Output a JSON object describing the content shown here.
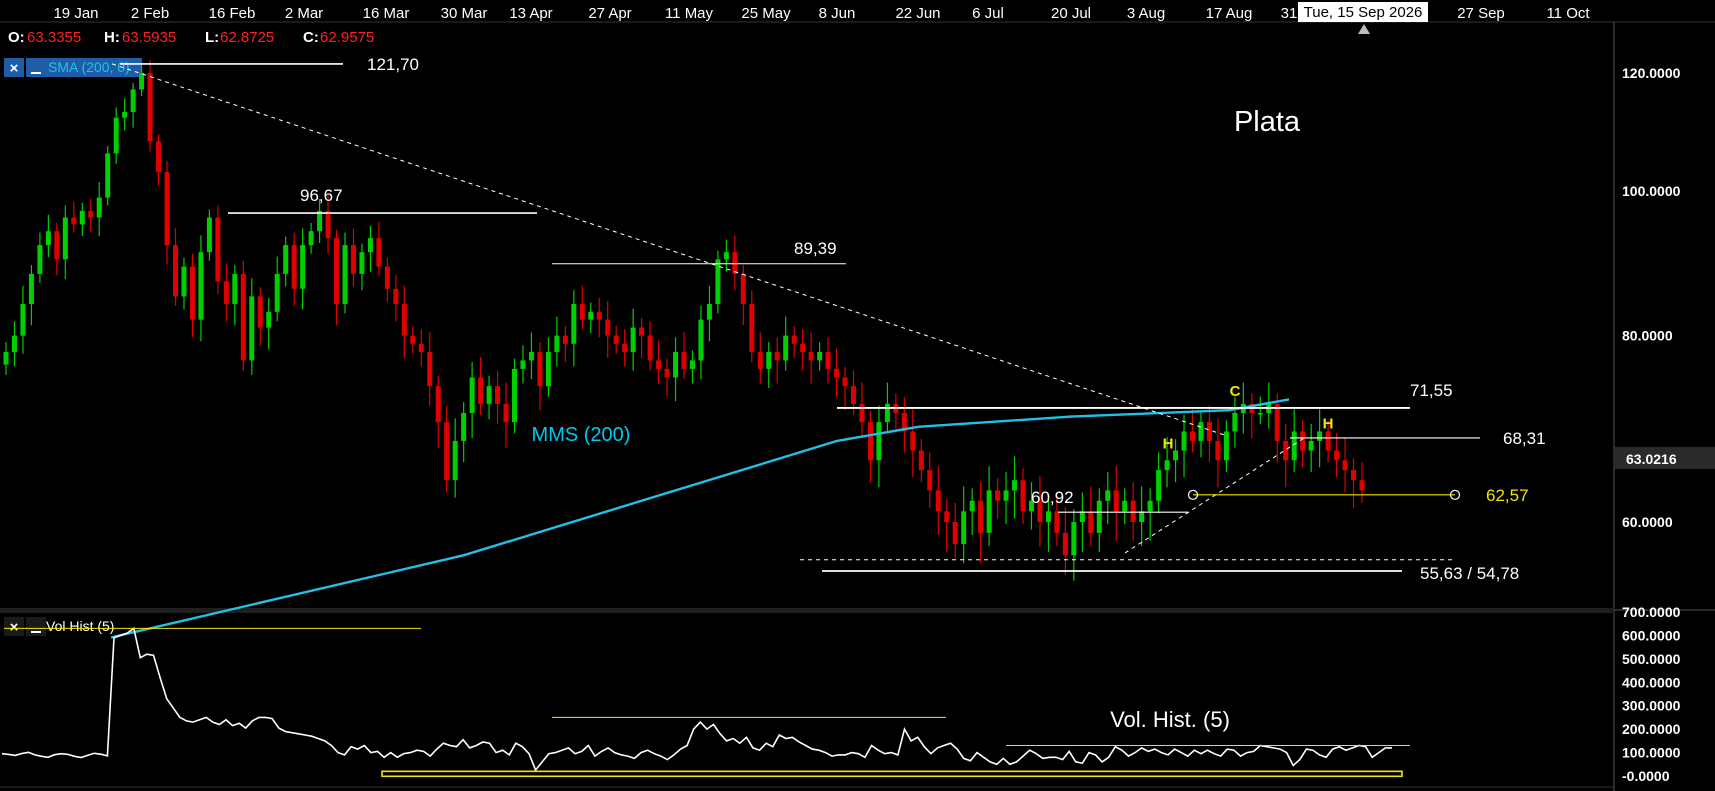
{
  "header": {
    "crosshair_date": "Tue, 15 Sep 2026",
    "ohlc": [
      {
        "label": "O:",
        "value": "63.3355"
      },
      {
        "label": "H:",
        "value": "63.5935"
      },
      {
        "label": "L:",
        "value": "62.8725"
      },
      {
        "label": "C:",
        "value": "62.9575"
      }
    ]
  },
  "colors": {
    "background": "#000000",
    "up": "#00d000",
    "down": "#e00000",
    "sma": "#23c0e6",
    "highlight": "#f2e600",
    "axis_text": "#ffffff",
    "ohlc_value": "#ff2020"
  },
  "icons": [
    "close-icon",
    "minimize-icon",
    "crosshair-marker-icon"
  ],
  "main_panel": {
    "indicator_label": "SMA (200, 0)",
    "title": "Plata",
    "sma_label": "MMS (200)",
    "price_tag": "63.0216"
  },
  "volume_panel": {
    "indicator_label": "Vol Hist (5)",
    "title": "Vol. Hist. (5)"
  },
  "chart_data": [
    {
      "type": "candlestick",
      "title": "Plata",
      "x_ticks": [
        "19 Jan",
        "2 Feb",
        "16 Feb",
        "2 Mar",
        "16 Mar",
        "30 Mar",
        "13 Apr",
        "27 Apr",
        "11 May",
        "25 May",
        "8 Jun",
        "22 Jun",
        "6 Jul",
        "20 Jul",
        "3 Aug",
        "17 Aug",
        "31",
        "27 Sep",
        "11 Oct"
      ],
      "y_ticks": [
        "120.0000",
        "100.0000",
        "80.0000",
        "60.0000"
      ],
      "ylim": [
        50,
        124
      ],
      "candles_closes": [
        78,
        80,
        84,
        88,
        92,
        94,
        90,
        96,
        95,
        97,
        96,
        99,
        106,
        112,
        113,
        117,
        120,
        108,
        103,
        92,
        85,
        89,
        82,
        91,
        96,
        87,
        84,
        88,
        77,
        85,
        81,
        83,
        88,
        92,
        86,
        92,
        94,
        97,
        93,
        84,
        92,
        88,
        91,
        93,
        89,
        86,
        84,
        80,
        79,
        78,
        74,
        70,
        64,
        68,
        71,
        75,
        72,
        74,
        72,
        70,
        76,
        77,
        78,
        74,
        78,
        80,
        79,
        84,
        82,
        83,
        82,
        80,
        79,
        78,
        81,
        80,
        77,
        76,
        75,
        78,
        76,
        77,
        82,
        84,
        90,
        91,
        88,
        84,
        78,
        76,
        78,
        77,
        80,
        79,
        78,
        77,
        78,
        76,
        75,
        74,
        72,
        70,
        66,
        70,
        72,
        71,
        69,
        67,
        65,
        63,
        61,
        60,
        58,
        61,
        62,
        59,
        63,
        62,
        63,
        64,
        61,
        62,
        60,
        61,
        59,
        57,
        60,
        61,
        59,
        62,
        63,
        61,
        62,
        60,
        61,
        62,
        65,
        66,
        67,
        69,
        68,
        70,
        68,
        66,
        69,
        71,
        72,
        71,
        71,
        72,
        68,
        66,
        69,
        67,
        68,
        69,
        67,
        66,
        65,
        64,
        63
      ],
      "sma_200": [
        {
          "x": "19 Jan",
          "y": 50.2
        },
        {
          "x": "30 Mar",
          "y": 57
        },
        {
          "x": "8 Jun",
          "y": 68
        },
        {
          "x": "22 Jun",
          "y": 69.5
        },
        {
          "x": "20 Jul",
          "y": 70.6
        },
        {
          "x": "17 Aug",
          "y": 71.3
        },
        {
          "x": "31",
          "y": 72.5
        }
      ],
      "levels": [
        {
          "label": "121,70",
          "value": 121.7
        },
        {
          "label": "96,67",
          "value": 96.67
        },
        {
          "label": "89,39",
          "value": 89.39
        },
        {
          "label": "71,55",
          "value": 71.55
        },
        {
          "label": "68,31",
          "value": 68.31
        },
        {
          "label": "62,57",
          "value": 62.57
        },
        {
          "label": "60,92",
          "value": 60.92
        },
        {
          "label": "55,63 / 54,78",
          "value": 55.63
        }
      ],
      "pattern_labels": [
        "H",
        "C",
        "H"
      ]
    },
    {
      "type": "line",
      "title": "Vol. Hist. (5)",
      "y_ticks": [
        "700.0000",
        "600.0000",
        "500.0000",
        "400.0000",
        "300.0000",
        "200.0000",
        "100.0000",
        "-0.0000"
      ],
      "ylim": [
        0,
        700
      ],
      "values": [
        95,
        92,
        88,
        96,
        101,
        90,
        84,
        80,
        91,
        95,
        92,
        84,
        79,
        88,
        97,
        93,
        86,
        590,
        600,
        610,
        630,
        505,
        520,
        515,
        420,
        330,
        290,
        250,
        235,
        230,
        240,
        250,
        230,
        220,
        240,
        215,
        225,
        205,
        235,
        250,
        250,
        245,
        205,
        190,
        185,
        180,
        175,
        170,
        160,
        150,
        130,
        100,
        90,
        125,
        115,
        130,
        100,
        105,
        80,
        100,
        80,
        95,
        100,
        110,
        105,
        85,
        115,
        140,
        130,
        125,
        155,
        120,
        130,
        145,
        140,
        100,
        110,
        90,
        140,
        125,
        95,
        25,
        60,
        95,
        100,
        110,
        120,
        95,
        105,
        130,
        85,
        105,
        120,
        100,
        90,
        85,
        75,
        100,
        110,
        95,
        85,
        70,
        90,
        115,
        130,
        200,
        230,
        200,
        220,
        180,
        150,
        160,
        140,
        165,
        120,
        110,
        140,
        125,
        175,
        160,
        165,
        145,
        130,
        115,
        110,
        100,
        85,
        90,
        90,
        100,
        95,
        80,
        130,
        110,
        95,
        100,
        90,
        200,
        150,
        165,
        125,
        95,
        120,
        130,
        140,
        115,
        75,
        65,
        100,
        80,
        60,
        50,
        75,
        50,
        60,
        85,
        110,
        95,
        75,
        80,
        80,
        70,
        105,
        60,
        55,
        100,
        90,
        60,
        80,
        125,
        110,
        85,
        100,
        120,
        105,
        115,
        100,
        90,
        115,
        100,
        85,
        110,
        95,
        110,
        95,
        85,
        115,
        110,
        85,
        100,
        105,
        130,
        125,
        120,
        115,
        100,
        45,
        70,
        115,
        110,
        90,
        80,
        115,
        125,
        110,
        120,
        130,
        125,
        80,
        100,
        120,
        120
      ]
    }
  ]
}
